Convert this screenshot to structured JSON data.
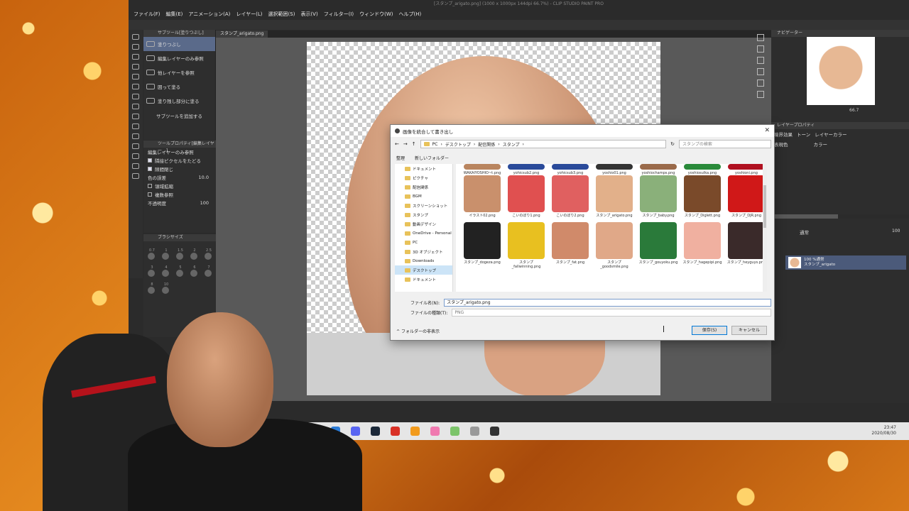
{
  "app": {
    "title": "[スタンプ_arigato.png] (1000 x 1000px 144dpi 66.7%) - CLIP STUDIO PAINT PRO",
    "menu": [
      "ファイル(F)",
      "編集(E)",
      "アニメーション(A)",
      "レイヤー(L)",
      "選択範囲(S)",
      "表示(V)",
      "フィルター(I)",
      "ウィンドウ(W)",
      "ヘルプ(H)"
    ],
    "document_tab": "スタンプ_arigato.png"
  },
  "subtool_panel": {
    "header": "サブツール[塗りつぶし]",
    "items": [
      {
        "label": "塗りつぶし",
        "selected": true
      },
      {
        "label": "編集レイヤーのみ参照",
        "selected": false
      },
      {
        "label": "他レイヤーを参照",
        "selected": false
      },
      {
        "label": "囲って塗る",
        "selected": false
      },
      {
        "label": "塗り残し部分に塗る",
        "selected": false
      }
    ],
    "add_label": "サブツールを追加する"
  },
  "tool_property": {
    "header": "ツールプロパティ[編集レイヤー...]",
    "title": "編集レイヤーのみ参照",
    "rows": [
      {
        "label": "隣接ピクセルをたどる",
        "checked": true
      },
      {
        "label": "隙間閉じ",
        "checked": true
      },
      {
        "label": "色の誤差",
        "value": "10.0"
      },
      {
        "label": "領域拡縮",
        "checked": false
      },
      {
        "label": "複数参照",
        "checked": false
      },
      {
        "label": "不透明度",
        "value": "100"
      }
    ]
  },
  "brush_size": {
    "header": "ブラシサイズ",
    "values": [
      "0.7",
      "1",
      "1.5",
      "2",
      "2.5",
      "3",
      "4",
      "5",
      "6",
      "7",
      "8",
      "10"
    ]
  },
  "navigator": {
    "header": "ナビゲーター",
    "zoom": "66.7"
  },
  "layer_property": {
    "header": "レイヤープロパティ",
    "effect": "境界効果",
    "tone": "トーン",
    "layer_color": "レイヤーカラー",
    "expression_color_label": "表現色",
    "expression_color": "カラー"
  },
  "layer_panel": {
    "blend_mode": "通常",
    "opacity": "100",
    "layer": {
      "opacity_label": "100 %通常",
      "name": "スタンプ_arigato"
    }
  },
  "dialog": {
    "title": "画像を統合して書き出し",
    "breadcrumb": [
      "PC",
      "デスクトップ",
      "配信関係",
      "スタンプ"
    ],
    "search_placeholder": "スタンプの検索",
    "organize": "整理",
    "new_folder": "新しいフォルダー",
    "tree": [
      {
        "label": "ドキュメント",
        "selected": false
      },
      {
        "label": "ピクチャ",
        "selected": false
      },
      {
        "label": "配信関係",
        "selected": false
      },
      {
        "label": "BGM",
        "selected": false
      },
      {
        "label": "スクリーンショット",
        "selected": false
      },
      {
        "label": "スタンプ",
        "selected": false
      },
      {
        "label": "動画デザイン",
        "selected": false
      },
      {
        "label": "OneDrive - Personal",
        "selected": false
      },
      {
        "label": "PC",
        "selected": false
      },
      {
        "label": "3D オブジェクト",
        "selected": false
      },
      {
        "label": "Downloads",
        "selected": false
      },
      {
        "label": "デスクトップ",
        "selected": true
      },
      {
        "label": "ドキュメント",
        "selected": false
      }
    ],
    "files_row1": [
      {
        "name": "WAKAIYOSHIO~t.png",
        "color": "#b9855f"
      },
      {
        "name": "yohicsub2.png",
        "color": "#2a4a9a"
      },
      {
        "name": "yohicsub3.png",
        "color": "#2a4a9a"
      },
      {
        "name": "yoshio01.png",
        "color": "#333333"
      },
      {
        "name": "yoshiochamps.png",
        "color": "#9a6a4a"
      },
      {
        "name": "yoshiosulka.png",
        "color": "#2a8a3a"
      },
      {
        "name": "yoshioni.png",
        "color": "#b01020"
      }
    ],
    "files_row2": [
      {
        "name": "イラスト02.png",
        "color": "#c9906c"
      },
      {
        "name": "こいのぼり1.png",
        "color": "#e05050"
      },
      {
        "name": "こいのぼり2.png",
        "color": "#e06060"
      },
      {
        "name": "スタンプ_arigato.png",
        "color": "#e2b08a"
      },
      {
        "name": "スタンプ_baby.png",
        "color": "#8ab07a"
      },
      {
        "name": "スタンプ_Diglett.png",
        "color": "#7a4a2a"
      },
      {
        "name": "スタンプ_DJR.png",
        "color": "#d01818"
      }
    ],
    "files_row3": [
      {
        "name": "スタンプ_dogeza.png",
        "color": "#222222"
      },
      {
        "name": "スタンプ_fallwinning.png",
        "color": "#e8c020"
      },
      {
        "name": "スタンプ_fat.png",
        "color": "#d08a6a"
      },
      {
        "name": "スタンプ_goodsmile.png",
        "color": "#e0a888"
      },
      {
        "name": "スタンプ_gouyoku.png",
        "color": "#2a7a3a"
      },
      {
        "name": "スタンプ_hagepipi.png",
        "color": "#f0b0a0"
      },
      {
        "name": "スタンプ_heyguys.png",
        "color": "#3a2a2a"
      }
    ],
    "filename_label": "ファイル名(N):",
    "filename_value": "スタンプ_arigato.png",
    "filetype_label": "ファイルの種類(T):",
    "filetype_value": "PNG",
    "hide_folders": "フォルダーの非表示",
    "save": "保存(S)",
    "cancel": "キャンセル"
  },
  "taskbar": {
    "icons": [
      {
        "name": "vscode-icon",
        "color": "#2b7bd6"
      },
      {
        "name": "discord-icon",
        "color": "#5865f2"
      },
      {
        "name": "steam-icon",
        "color": "#1b2838"
      },
      {
        "name": "chrome-icon",
        "color": "#d93025"
      },
      {
        "name": "obs-icon",
        "color": "#f29b1d"
      },
      {
        "name": "pig-icon",
        "color": "#f07ab0"
      },
      {
        "name": "v-icon",
        "color": "#7cc46a"
      },
      {
        "name": "settings-icon",
        "color": "#999999"
      },
      {
        "name": "clip-studio-icon",
        "color": "#333333"
      }
    ],
    "time": "23:47",
    "date": "2020/08/30"
  }
}
